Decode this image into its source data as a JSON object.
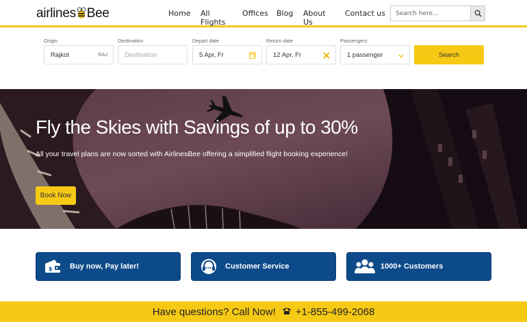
{
  "brand": {
    "logo_part1": "airlines",
    "logo_part2": "Bee"
  },
  "nav": {
    "items": [
      {
        "label": "Home"
      },
      {
        "label": "All Flights"
      },
      {
        "label": "Offices"
      },
      {
        "label": "Blog"
      },
      {
        "label": "About Us"
      },
      {
        "label": "Contact us"
      }
    ]
  },
  "search": {
    "placeholder": "Search here..."
  },
  "booking": {
    "origin_label": "Origin",
    "origin_value": "Rajkot",
    "origin_code": "RAJ",
    "destination_label": "Destination",
    "destination_placeholder": "Destination",
    "depart_label": "Depart date",
    "depart_value": "5 Apr, Fr",
    "return_label": "Return date",
    "return_value": "12 Apr, Fr",
    "passengers_label": "Passengers",
    "passengers_value": "1 passenger",
    "search_button": "Search"
  },
  "hero": {
    "title": "Fly the Skies with Savings of up to 30%",
    "subtitle": "All your travel plans are now sorted with AirlinesBee offering a simplified flight booking experience!",
    "cta": "Book Now"
  },
  "features": [
    {
      "label": "Buy now, Pay later!",
      "icon": "wallet-icon"
    },
    {
      "label": "Customer Service",
      "icon": "headset-icon"
    },
    {
      "label": "1000+ Customers",
      "icon": "users-icon"
    }
  ],
  "footer": {
    "question": "Have questions? Call Now!",
    "phone": "+1-855-499-2068"
  },
  "colors": {
    "accent": "#f6c915",
    "card_blue": "#0d4a8a"
  }
}
